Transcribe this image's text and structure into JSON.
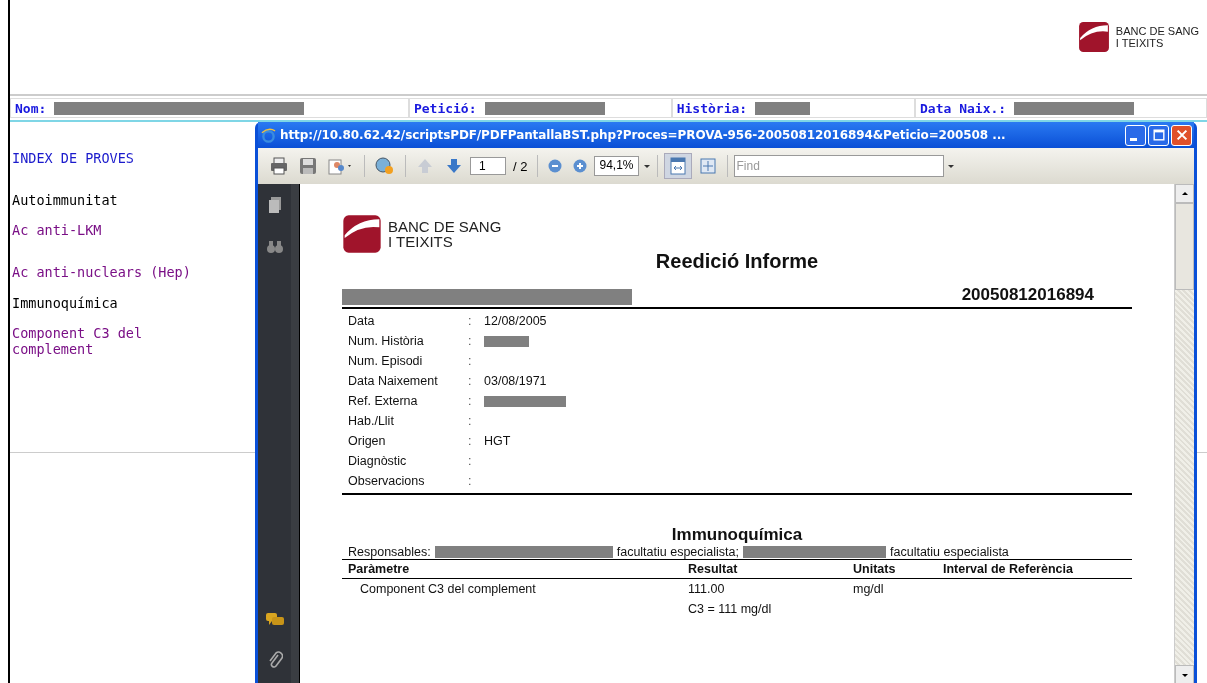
{
  "header": {
    "logo": {
      "line1": "BANC DE SANG",
      "line2": "I TEIXITS"
    }
  },
  "patient_bar": {
    "fields": [
      {
        "label": "Nom:"
      },
      {
        "label": "Petició:"
      },
      {
        "label": "Història:"
      },
      {
        "label": "Data Naix.:"
      }
    ]
  },
  "index": [
    {
      "kind": "heading",
      "text": "INDEX DE PROVES"
    },
    {
      "kind": "category",
      "text": "Autoimmunitat"
    },
    {
      "kind": "test",
      "text": "Ac anti-LKM"
    },
    {
      "kind": "test",
      "text": "Ac anti-nuclears (Hep)"
    },
    {
      "kind": "category",
      "text": "Immunoquímica"
    },
    {
      "kind": "test",
      "text": "Component C3 del complement"
    }
  ],
  "popup": {
    "title": "http://10.80.62.42/scriptsPDF/PDFPantallaBST.php?Proces=PROVA-956-20050812016894&Peticio=200508 ...",
    "toolbar": {
      "page": "1",
      "page_count": "/ 2",
      "zoom": "94,1%",
      "find_placeholder": "Find"
    },
    "document": {
      "logo": {
        "line1": "BANC DE SANG",
        "line2": "I TEIXITS"
      },
      "title": "Reedició Informe",
      "number": "20050812016894",
      "info": [
        {
          "label": "Data",
          "sep": ":",
          "value": "12/08/2005",
          "redacted": false
        },
        {
          "label": "Num. Història",
          "sep": ":",
          "redacted": true
        },
        {
          "label": "Num. Episodi",
          "sep": ":",
          "redacted": false
        },
        {
          "label": "Data Naixement",
          "sep": ":",
          "value": "03/08/1971",
          "redacted": false
        },
        {
          "label": "Ref. Externa",
          "sep": ":",
          "redacted": true
        },
        {
          "label": "Hab./Llit",
          "sep": ":",
          "redacted": false
        },
        {
          "label": "Origen",
          "sep": ":",
          "value": "HGT",
          "redacted": false
        },
        {
          "label": "Diagnòstic",
          "sep": ":",
          "redacted": false
        },
        {
          "label": "Observacions",
          "sep": ":",
          "redacted": false
        }
      ],
      "section": "Immunoquímica",
      "responsables": {
        "label": "Responsables:",
        "role1": "facultatiu especialista;",
        "role2": "facultatiu especialista"
      },
      "table": {
        "columns": [
          "Paràmetre",
          "Resultat",
          "Unitats",
          "Interval de Referència"
        ],
        "rows": [
          {
            "parameter": "Component C3 del complement",
            "result": "111.00",
            "units": "mg/dl",
            "note": "C3 = 111 mg/dl"
          }
        ]
      }
    }
  }
}
